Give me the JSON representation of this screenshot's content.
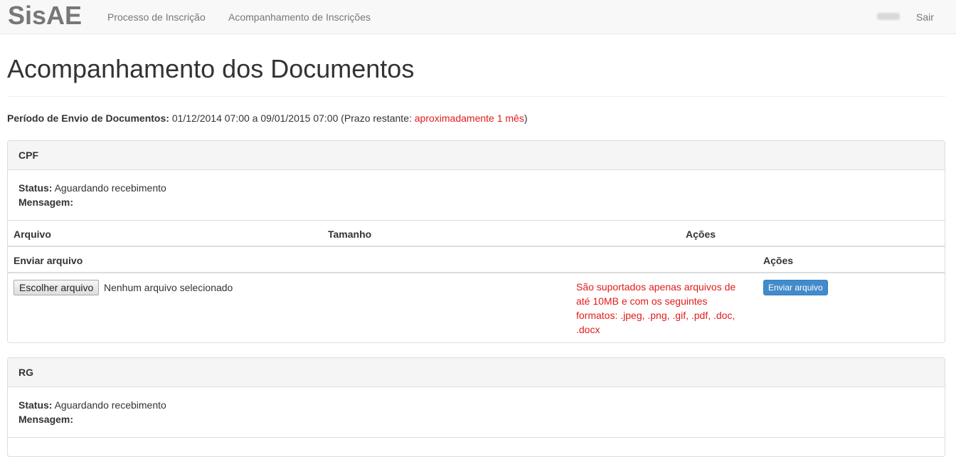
{
  "navbar": {
    "brand": "SisAE",
    "links": [
      "Processo de Inscrição",
      "Acompanhamento de Inscrições"
    ],
    "logout": "Sair"
  },
  "page": {
    "title": "Acompanhamento dos Documentos",
    "period_label": "Período de Envio de Documentos:",
    "period_range": "01/12/2014 07:00 a 09/01/2015 07:00",
    "deadline_prefix": "(Prazo restante:",
    "deadline_value": "aproximadamente 1 mês",
    "deadline_suffix": ")"
  },
  "labels": {
    "status": "Status:",
    "message": "Mensagem:",
    "col_file": "Arquivo",
    "col_size": "Tamanho",
    "col_actions": "Ações",
    "upload_header": "Enviar arquivo",
    "upload_actions": "Ações",
    "choose_file": "Escolher arquivo",
    "no_file": "Nenhum arquivo selecionado",
    "formats_note": "São suportados apenas arquivos de até 10MB e com os seguintes formatos: .jpeg, .png, .gif, .pdf, .doc, .docx",
    "send_button": "Enviar arquivo"
  },
  "documents": [
    {
      "name": "CPF",
      "status": "Aguardando recebimento",
      "message": ""
    },
    {
      "name": "RG",
      "status": "Aguardando recebimento",
      "message": ""
    }
  ],
  "colors": {
    "brand_gray": "#777777",
    "warning_red": "#e31b1b",
    "primary_blue": "#428bca"
  }
}
